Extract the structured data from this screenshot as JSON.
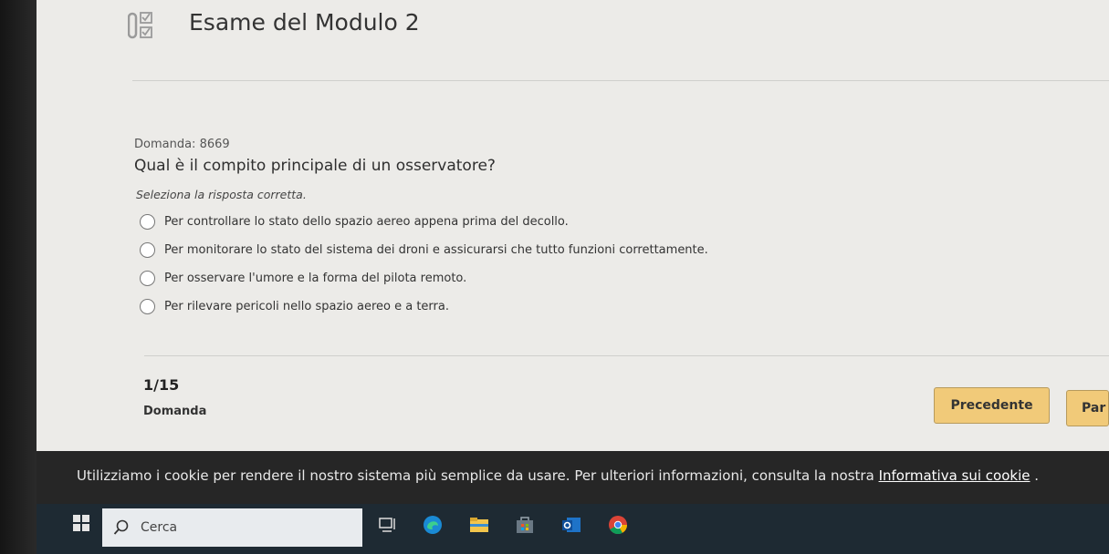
{
  "exam": {
    "title": "Esame del Modulo 2"
  },
  "question": {
    "number_label": "Domanda: 8669",
    "text": "Qual è il compito principale di un osservatore?",
    "instruction": "Seleziona la risposta corretta.",
    "options": [
      {
        "label": "Per controllare lo stato dello spazio aereo appena prima del decollo."
      },
      {
        "label": "Per monitorare lo stato del sistema dei droni e assicurarsi che tutto funzioni correttamente."
      },
      {
        "label": "Per osservare l'umore e la forma del pilota remoto."
      },
      {
        "label": "Per rilevare pericoli nello spazio aereo e a terra."
      }
    ]
  },
  "progress": {
    "count": "1/15",
    "label": "Domanda"
  },
  "nav": {
    "previous_label": "Precedente",
    "next_label": "Par"
  },
  "cookie_banner": {
    "text": "Utilizziamo i cookie per rendere il nostro sistema più semplice da usare. Per ulteriori informazioni, consulta la nostra ",
    "link_label": "Informativa sui cookie",
    "suffix": " ."
  },
  "taskbar": {
    "search_placeholder": "Cerca",
    "icons": [
      "windows-start-icon",
      "search-icon",
      "task-view-icon",
      "edge-icon",
      "file-explorer-icon",
      "store-icon",
      "outlook-icon",
      "chrome-icon"
    ]
  },
  "colors": {
    "button_bg": "#f1ca79",
    "button_border": "#b79a5c",
    "page_bg": "#ecebe8",
    "cookie_bg": "#262626",
    "taskbar_bg": "#1e2a33"
  }
}
